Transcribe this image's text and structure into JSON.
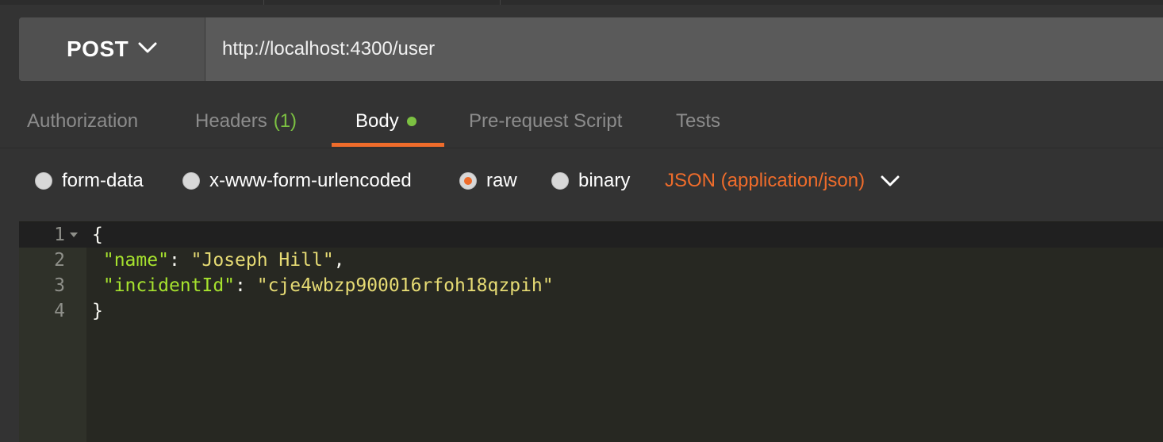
{
  "request": {
    "method": "POST",
    "url": "http://localhost:4300/user"
  },
  "tabs": [
    {
      "label": "Authorization"
    },
    {
      "label": "Headers",
      "count": "(1)"
    },
    {
      "label": "Body"
    },
    {
      "label": "Pre-request Script"
    },
    {
      "label": "Tests"
    }
  ],
  "active_tab": "Body",
  "body_types": [
    {
      "label": "form-data",
      "checked": false
    },
    {
      "label": "x-www-form-urlencoded",
      "checked": false
    },
    {
      "label": "raw",
      "checked": true
    },
    {
      "label": "binary",
      "checked": false
    }
  ],
  "content_type": "JSON (application/json)",
  "editor": {
    "line_numbers": [
      "1",
      "2",
      "3",
      "4"
    ],
    "lines": [
      {
        "open": "{"
      },
      {
        "key": "\"name\"",
        "sep": ": ",
        "value": "\"Joseph Hill\"",
        "tail": ","
      },
      {
        "key": "\"incidentId\"",
        "sep": ": ",
        "value": "\"cje4wbzp900016rfoh18qzpih\"",
        "tail": ""
      },
      {
        "close": "}"
      }
    ]
  },
  "colors": {
    "accent": "#ef6c2b",
    "status_green": "#7cc142",
    "json_key": "#a6e22e",
    "json_string": "#e6db74"
  }
}
